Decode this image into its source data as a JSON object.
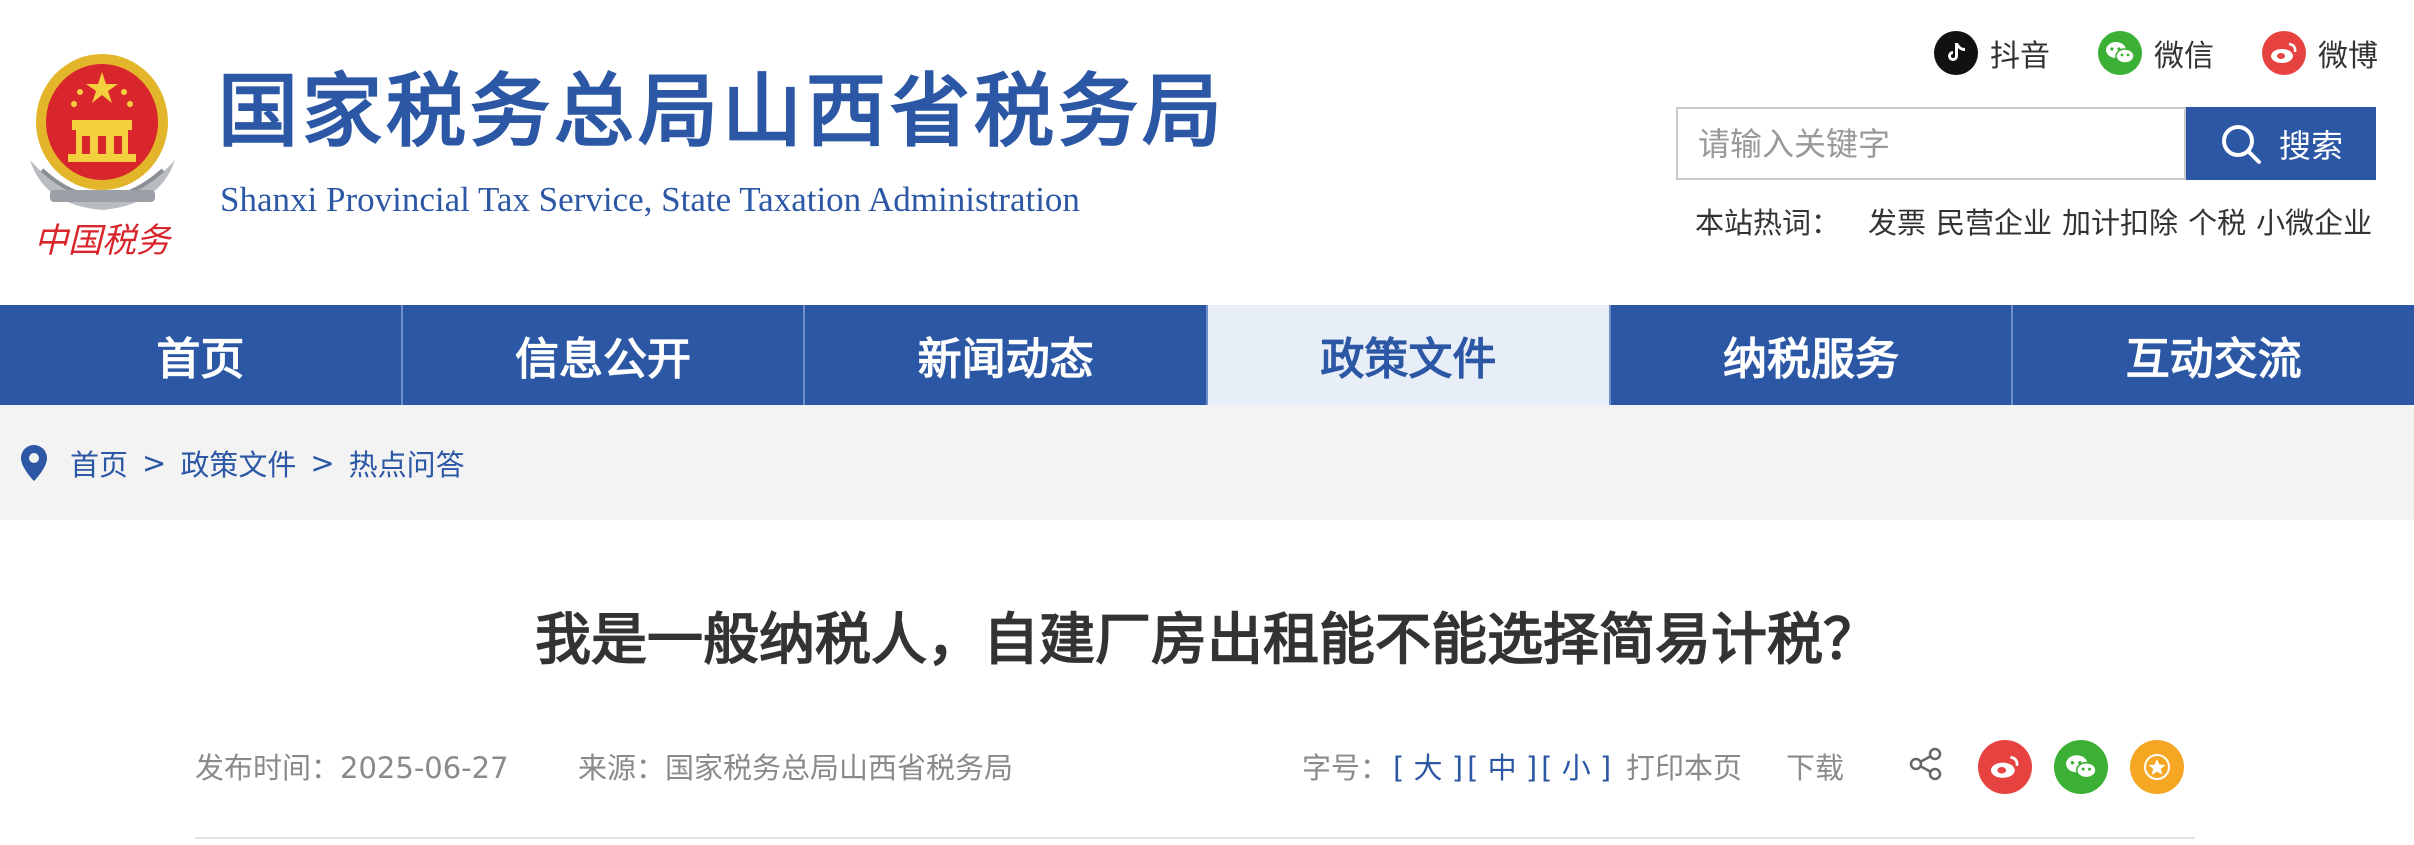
{
  "header": {
    "site_title": "国家税务总局山西省税务局",
    "site_subtitle": "Shanxi Provincial Tax Service, State Taxation Administration",
    "emblem_caption": "中国税务",
    "social": [
      {
        "icon": "douyin-icon",
        "label": "抖音",
        "color": "#111111"
      },
      {
        "icon": "wechat-icon",
        "label": "微信",
        "color": "#3cb034"
      },
      {
        "icon": "weibo-icon",
        "label": "微博",
        "color": "#e6423f"
      }
    ],
    "search": {
      "placeholder": "请输入关键字",
      "button_label": "搜索"
    },
    "hotwords": {
      "label": "本站热词：",
      "items": [
        "发票",
        "民营企业",
        "加计扣除",
        "个税",
        "小微企业"
      ]
    }
  },
  "nav": {
    "items": [
      {
        "label": "首页",
        "active": false
      },
      {
        "label": "信息公开",
        "active": false
      },
      {
        "label": "新闻动态",
        "active": false
      },
      {
        "label": "政策文件",
        "active": true
      },
      {
        "label": "纳税服务",
        "active": false
      },
      {
        "label": "互动交流",
        "active": false
      }
    ]
  },
  "breadcrumb": {
    "items": [
      "首页",
      "政策文件",
      "热点问答"
    ],
    "separator": ">"
  },
  "article": {
    "title": "我是一般纳税人，自建厂房出租能不能选择简易计税？",
    "publish_label": "发布时间：",
    "publish_date": "2025-06-27",
    "source_label": "来源：",
    "source": "国家税务总局山西省税务局",
    "fontsize_label": "字号：",
    "fontsize_large": "[ 大 ]",
    "fontsize_medium": "[ 中 ]",
    "fontsize_small": "[ 小 ]",
    "print_label": "打印本页",
    "download_label": "下载"
  },
  "colors": {
    "brand_blue": "#2b57a5",
    "nav_active_bg": "#e8eef8",
    "share_weibo": "#e6423f",
    "share_wechat": "#3cb034",
    "share_favorite": "#f5a623"
  }
}
